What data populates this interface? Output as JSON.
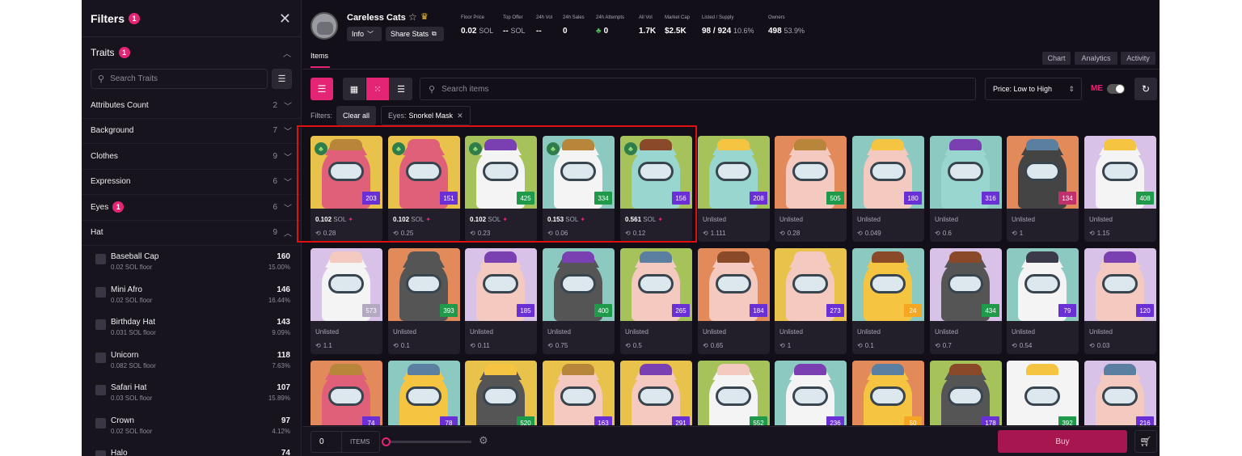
{
  "sidebar": {
    "title": "Filters",
    "filter_count": "1",
    "traits_label": "Traits",
    "traits_count": "1",
    "search_placeholder": "Search Traits",
    "attributes": [
      {
        "label": "Attributes Count",
        "count": "2",
        "badge": ""
      },
      {
        "label": "Background",
        "count": "7",
        "badge": ""
      },
      {
        "label": "Clothes",
        "count": "9",
        "badge": ""
      },
      {
        "label": "Expression",
        "count": "6",
        "badge": ""
      },
      {
        "label": "Eyes",
        "count": "6",
        "badge": "1"
      },
      {
        "label": "Hat",
        "count": "9",
        "badge": ""
      }
    ],
    "hat_values": [
      {
        "name": "Baseball Cap",
        "floor": "0.02 SOL floor",
        "count": "160",
        "pct": "15.00%"
      },
      {
        "name": "Mini Afro",
        "floor": "0.02 SOL floor",
        "count": "146",
        "pct": "16.44%"
      },
      {
        "name": "Birthday Hat",
        "floor": "0.031 SOL floor",
        "count": "143",
        "pct": "9.09%"
      },
      {
        "name": "Unicorn",
        "floor": "0.082 SOL floor",
        "count": "118",
        "pct": "7.63%"
      },
      {
        "name": "Safari Hat",
        "floor": "0.03 SOL floor",
        "count": "107",
        "pct": "15.89%"
      },
      {
        "name": "Crown",
        "floor": "0.02 SOL floor",
        "count": "97",
        "pct": "4.12%"
      },
      {
        "name": "Halo",
        "floor": "",
        "count": "74",
        "pct": ""
      }
    ]
  },
  "collection": {
    "name": "Careless Cats",
    "info_label": "Info",
    "share_label": "Share Stats",
    "stats": [
      {
        "key": "Floor Price",
        "value": "0.02",
        "unit": "SOL"
      },
      {
        "key": "Top Offer",
        "value": "--",
        "unit": "SOL"
      },
      {
        "key": "24h Vol",
        "value": "--",
        "unit": ""
      },
      {
        "key": "24h Sales",
        "value": "0",
        "unit": ""
      },
      {
        "key": "24h Attempts",
        "value": "0",
        "unit": ""
      },
      {
        "key": "All Vol",
        "value": "1.7K",
        "unit": ""
      },
      {
        "key": "Market Cap",
        "value": "$2.5K",
        "unit": ""
      },
      {
        "key": "Listed / Supply",
        "value": "98 / 924",
        "unit": "10.6%"
      },
      {
        "key": "Owners",
        "value": "498",
        "unit": "53.9%"
      }
    ]
  },
  "tabs": {
    "items": "Items",
    "chart": "Chart",
    "analytics": "Analytics",
    "activity": "Activity"
  },
  "toolbar": {
    "search_placeholder": "Search items",
    "sort": "Price: Low to High",
    "me_logo": "ME"
  },
  "filters": {
    "label": "Filters:",
    "clear_all": "Clear all",
    "chip_key": "Eyes:",
    "chip_value": "Snorkel Mask"
  },
  "cards": [
    {
      "rank": "203",
      "price": "0.102",
      "last": "0.28",
      "bg": "#e8c24a",
      "cat": "#e0607a",
      "hat": "#b8863a",
      "rankbg": "#6b2fd6",
      "clover": true,
      "listed": true
    },
    {
      "rank": "151",
      "price": "0.102",
      "last": "0.25",
      "bg": "#e8c24a",
      "cat": "#e0607a",
      "hat": "#e0607a",
      "rankbg": "#6b2fd6",
      "clover": true,
      "listed": true
    },
    {
      "rank": "425",
      "price": "0.102",
      "last": "0.23",
      "bg": "#a6c25a",
      "cat": "#f4f4f4",
      "hat": "#7a3fb0",
      "rankbg": "#1f9a4a",
      "clover": true,
      "listed": true
    },
    {
      "rank": "334",
      "price": "0.153",
      "last": "0.06",
      "bg": "#8cc9c0",
      "cat": "#f4f4f4",
      "hat": "#b8863a",
      "rankbg": "#1f9a4a",
      "clover": true,
      "listed": true
    },
    {
      "rank": "156",
      "price": "0.561",
      "last": "0.12",
      "bg": "#a6c25a",
      "cat": "#9ad6d0",
      "hat": "#8a4a2a",
      "rankbg": "#6b2fd6",
      "clover": true,
      "listed": true
    },
    {
      "rank": "208",
      "price": "Unlisted",
      "last": "1.111",
      "bg": "#a6c25a",
      "cat": "#9ad6d0",
      "hat": "#f5c542",
      "rankbg": "#6b2fd6",
      "clover": false,
      "listed": false
    },
    {
      "rank": "505",
      "price": "Unlisted",
      "last": "0.28",
      "bg": "#e38a5a",
      "cat": "#f4c9c0",
      "hat": "#b8863a",
      "rankbg": "#1f9a4a",
      "clover": false,
      "listed": false
    },
    {
      "rank": "180",
      "price": "Unlisted",
      "last": "0.049",
      "bg": "#8cc9c0",
      "cat": "#f4c9c0",
      "hat": "#f5c542",
      "rankbg": "#6b2fd6",
      "clover": false,
      "listed": false
    },
    {
      "rank": "316",
      "price": "Unlisted",
      "last": "0.6",
      "bg": "#8cc9c0",
      "cat": "#9ad6d0",
      "hat": "#7a3fb0",
      "rankbg": "#6b2fd6",
      "clover": false,
      "listed": false
    },
    {
      "rank": "134",
      "price": "Unlisted",
      "last": "1",
      "bg": "#e38a5a",
      "cat": "#444",
      "hat": "#5a7fa0",
      "rankbg": "#c0306a",
      "clover": false,
      "listed": false
    },
    {
      "rank": "408",
      "price": "Unlisted",
      "last": "1.15",
      "bg": "#d9c2e8",
      "cat": "#f4f4f4",
      "hat": "#f5c542",
      "rankbg": "#1f9a4a",
      "clover": false,
      "listed": false
    },
    {
      "rank": "573",
      "price": "Unlisted",
      "last": "1.1",
      "bg": "#d9c2e8",
      "cat": "#f4f4f4",
      "hat": "#f4c9c0",
      "rankbg": "#b5a9c2",
      "clover": false,
      "listed": false
    },
    {
      "rank": "393",
      "price": "Unlisted",
      "last": "0.1",
      "bg": "#e38a5a",
      "cat": "#555",
      "hat": "#555",
      "rankbg": "#1f9a4a",
      "clover": false,
      "listed": false
    },
    {
      "rank": "185",
      "price": "Unlisted",
      "last": "0.11",
      "bg": "#d9c2e8",
      "cat": "#f4c9c0",
      "hat": "#7a3fb0",
      "rankbg": "#6b2fd6",
      "clover": false,
      "listed": false
    },
    {
      "rank": "400",
      "price": "Unlisted",
      "last": "0.75",
      "bg": "#8cc9c0",
      "cat": "#555",
      "hat": "#7a3fb0",
      "rankbg": "#1f9a4a",
      "clover": false,
      "listed": false
    },
    {
      "rank": "265",
      "price": "Unlisted",
      "last": "0.5",
      "bg": "#a6c25a",
      "cat": "#f4c9c0",
      "hat": "#5a7fa0",
      "rankbg": "#6b2fd6",
      "clover": false,
      "listed": false
    },
    {
      "rank": "184",
      "price": "Unlisted",
      "last": "0.65",
      "bg": "#e38a5a",
      "cat": "#f4c9c0",
      "hat": "#8a4a2a",
      "rankbg": "#6b2fd6",
      "clover": false,
      "listed": false
    },
    {
      "rank": "273",
      "price": "Unlisted",
      "last": "1",
      "bg": "#e8c24a",
      "cat": "#f4c9c0",
      "hat": "#f4c9c0",
      "rankbg": "#6b2fd6",
      "clover": false,
      "listed": false
    },
    {
      "rank": "24",
      "price": "Unlisted",
      "last": "0.1",
      "bg": "#8cc9c0",
      "cat": "#f5c542",
      "hat": "#8a4a2a",
      "rankbg": "#f5a623",
      "clover": false,
      "listed": false
    },
    {
      "rank": "434",
      "price": "Unlisted",
      "last": "0.7",
      "bg": "#d9c2e8",
      "cat": "#555",
      "hat": "#8a4a2a",
      "rankbg": "#1f9a4a",
      "clover": false,
      "listed": false
    },
    {
      "rank": "79",
      "price": "Unlisted",
      "last": "0.54",
      "bg": "#8cc9c0",
      "cat": "#f4f4f4",
      "hat": "#3a3a4a",
      "rankbg": "#6b2fd6",
      "clover": false,
      "listed": false
    },
    {
      "rank": "120",
      "price": "Unlisted",
      "last": "0.03",
      "bg": "#d9c2e8",
      "cat": "#f4c9c0",
      "hat": "#7a3fb0",
      "rankbg": "#6b2fd6",
      "clover": false,
      "listed": false
    },
    {
      "rank": "74",
      "price": "",
      "last": "",
      "bg": "#e38a5a",
      "cat": "#e0607a",
      "hat": "#b8863a",
      "rankbg": "#6b2fd6",
      "clover": false,
      "listed": false
    },
    {
      "rank": "78",
      "price": "",
      "last": "",
      "bg": "#8cc9c0",
      "cat": "#f5c542",
      "hat": "#5a7fa0",
      "rankbg": "#6b2fd6",
      "clover": false,
      "listed": false
    },
    {
      "rank": "520",
      "price": "",
      "last": "",
      "bg": "#e8c24a",
      "cat": "#555",
      "hat": "#f5c542",
      "rankbg": "#1f9a4a",
      "clover": false,
      "listed": false
    },
    {
      "rank": "163",
      "price": "",
      "last": "",
      "bg": "#e8c24a",
      "cat": "#f4c9c0",
      "hat": "#b8863a",
      "rankbg": "#6b2fd6",
      "clover": false,
      "listed": false
    },
    {
      "rank": "291",
      "price": "",
      "last": "",
      "bg": "#e8c24a",
      "cat": "#f4c9c0",
      "hat": "#7a3fb0",
      "rankbg": "#6b2fd6",
      "clover": false,
      "listed": false
    },
    {
      "rank": "552",
      "price": "",
      "last": "",
      "bg": "#a6c25a",
      "cat": "#f4f4f4",
      "hat": "#f4c9c0",
      "rankbg": "#1f9a4a",
      "clover": false,
      "listed": false
    },
    {
      "rank": "236",
      "price": "",
      "last": "",
      "bg": "#8cc9c0",
      "cat": "#f4f4f4",
      "hat": "#7a3fb0",
      "rankbg": "#6b2fd6",
      "clover": false,
      "listed": false
    },
    {
      "rank": "50",
      "price": "",
      "last": "",
      "bg": "#e38a5a",
      "cat": "#f5c542",
      "hat": "#5a7fa0",
      "rankbg": "#f5a623",
      "clover": false,
      "listed": false
    },
    {
      "rank": "178",
      "price": "",
      "last": "",
      "bg": "#a6c25a",
      "cat": "#555",
      "hat": "#8a4a2a",
      "rankbg": "#6b2fd6",
      "clover": false,
      "listed": false
    },
    {
      "rank": "392",
      "price": "",
      "last": "",
      "bg": "#f4f4f4",
      "cat": "#f4f4f4",
      "hat": "#f5c542",
      "rankbg": "#1f9a4a",
      "clover": false,
      "listed": false
    },
    {
      "rank": "216",
      "price": "",
      "last": "",
      "bg": "#d9c2e8",
      "cat": "#f4c9c0",
      "hat": "#5a7fa0",
      "rankbg": "#6b2fd6",
      "clover": false,
      "listed": false
    }
  ],
  "bottom": {
    "quantity": "0",
    "items_label": "ITEMS",
    "buy_label": "Buy"
  },
  "colors": {
    "accent": "#e42575",
    "highlight_box": "#e01010",
    "buy": "#a8164f"
  }
}
